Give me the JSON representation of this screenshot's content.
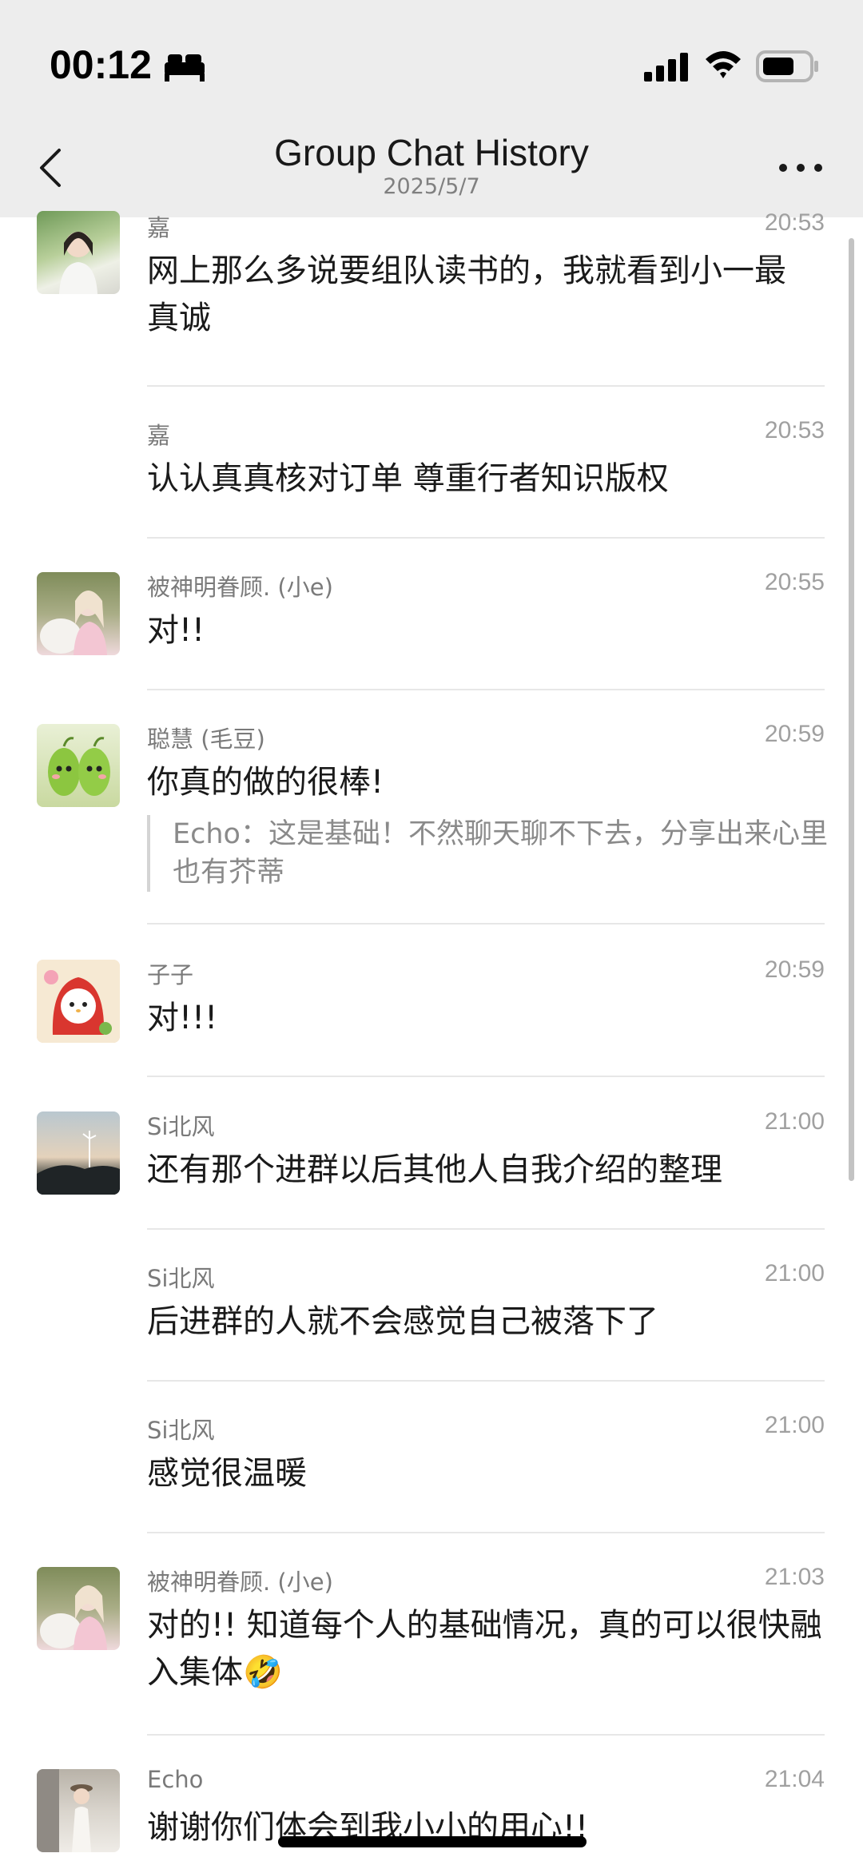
{
  "status_bar": {
    "time": "00:12"
  },
  "nav": {
    "title": "Group Chat History",
    "date": "2025/5/7"
  },
  "messages": [
    {
      "sender": "嘉",
      "time": "20:53",
      "text": "网上那么多说要组队读书的，我就看到小一最真诚"
    },
    {
      "sender": "嘉",
      "time": "20:53",
      "text": "认认真真核对订单 尊重行者知识版权"
    },
    {
      "sender": "被神明眷顾. (小e)",
      "time": "20:55",
      "text": "对!!"
    },
    {
      "sender": "聪慧 (毛豆)",
      "time": "20:59",
      "text": "你真的做的很棒!",
      "quote": "Echo：这是基础！不然聊天聊不下去，分享出来心里也有芥蒂"
    },
    {
      "sender": "子子",
      "time": "20:59",
      "text": "对!!!"
    },
    {
      "sender": "Si北风",
      "time": "21:00",
      "text": "还有那个进群以后其他人自我介绍的整理"
    },
    {
      "sender": "Si北风",
      "time": "21:00",
      "text": "后进群的人就不会感觉自己被落下了"
    },
    {
      "sender": "Si北风",
      "time": "21:00",
      "text": "感觉很温暖"
    },
    {
      "sender": "被神明眷顾. (小e)",
      "time": "21:03",
      "text": "对的!! 知道每个人的基础情况，真的可以很快融入集体🤣"
    },
    {
      "sender": "Echo",
      "time": "21:04",
      "text": "谢谢你们体会到我小小的用心!!"
    }
  ],
  "icons": {
    "bed": "bed-icon",
    "signal": "signal-icon",
    "wifi": "wifi-icon",
    "battery": "battery-icon",
    "back": "chevron-left-icon",
    "more": "more-dots-icon"
  },
  "colors": {
    "header_bg": "#ededed",
    "text": "#191919",
    "meta": "#a0a0a0"
  }
}
